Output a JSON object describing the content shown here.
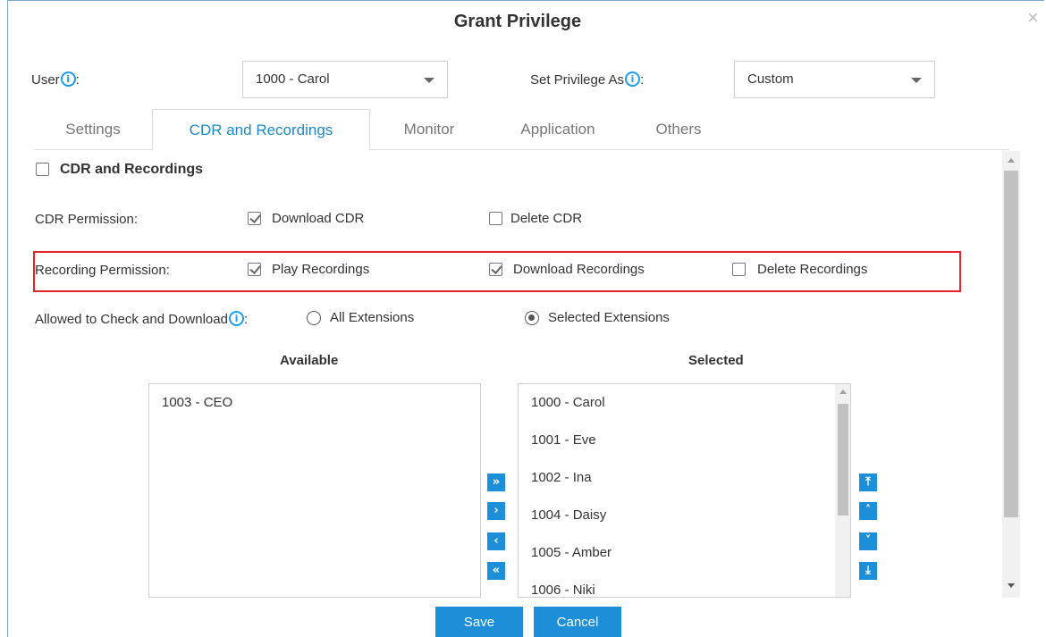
{
  "dialog": {
    "title": "Grant Privilege",
    "close": "×"
  },
  "user": {
    "label": "User",
    "suffix": ":",
    "value": "1000 - Carol"
  },
  "privilege": {
    "label": "Set Privilege As",
    "suffix": ":",
    "value": "Custom"
  },
  "tabs": [
    "Settings",
    "CDR and Recordings",
    "Monitor",
    "Application",
    "Others"
  ],
  "active_tab": "CDR and Recordings",
  "section": {
    "label": "CDR and Recordings",
    "checked": false
  },
  "cdr_permission": {
    "label": "CDR Permission:",
    "options": [
      {
        "label": "Download CDR",
        "checked": true
      },
      {
        "label": "Delete CDR",
        "checked": false
      }
    ]
  },
  "recording_permission": {
    "label": "Recording Permission:",
    "options": [
      {
        "label": "Play Recordings",
        "checked": true
      },
      {
        "label": "Download Recordings",
        "checked": true
      },
      {
        "label": "Delete Recordings",
        "checked": false
      }
    ]
  },
  "allowed": {
    "label": "Allowed to Check and Download",
    "suffix": ":",
    "options": [
      {
        "label": "All Extensions",
        "selected": false
      },
      {
        "label": "Selected Extensions",
        "selected": true
      }
    ]
  },
  "available": {
    "header": "Available",
    "items": [
      "1003 - CEO"
    ]
  },
  "selected": {
    "header": "Selected",
    "items": [
      "1000 - Carol",
      "1001 - Eve",
      "1002 - Ina",
      "1004 - Daisy",
      "1005 - Amber",
      "1006 - Niki"
    ]
  },
  "transfer_buttons": [
    {
      "name": "move-all-right-button",
      "glyph": "»"
    },
    {
      "name": "move-right-button",
      "glyph": "›"
    },
    {
      "name": "move-left-button",
      "glyph": "‹"
    },
    {
      "name": "move-all-left-button",
      "glyph": "«"
    }
  ],
  "order_buttons": [
    {
      "name": "move-top-button",
      "glyph": "⤒"
    },
    {
      "name": "move-up-button",
      "glyph": "˄"
    },
    {
      "name": "move-down-button",
      "glyph": "˅"
    },
    {
      "name": "move-bottom-button",
      "glyph": "⤓"
    }
  ],
  "buttons": {
    "save": "Save",
    "cancel": "Cancel"
  },
  "colors": {
    "accent": "#1d8fd8",
    "highlight_border": "#e8242a",
    "tab_active_text": "#1e88c7"
  }
}
